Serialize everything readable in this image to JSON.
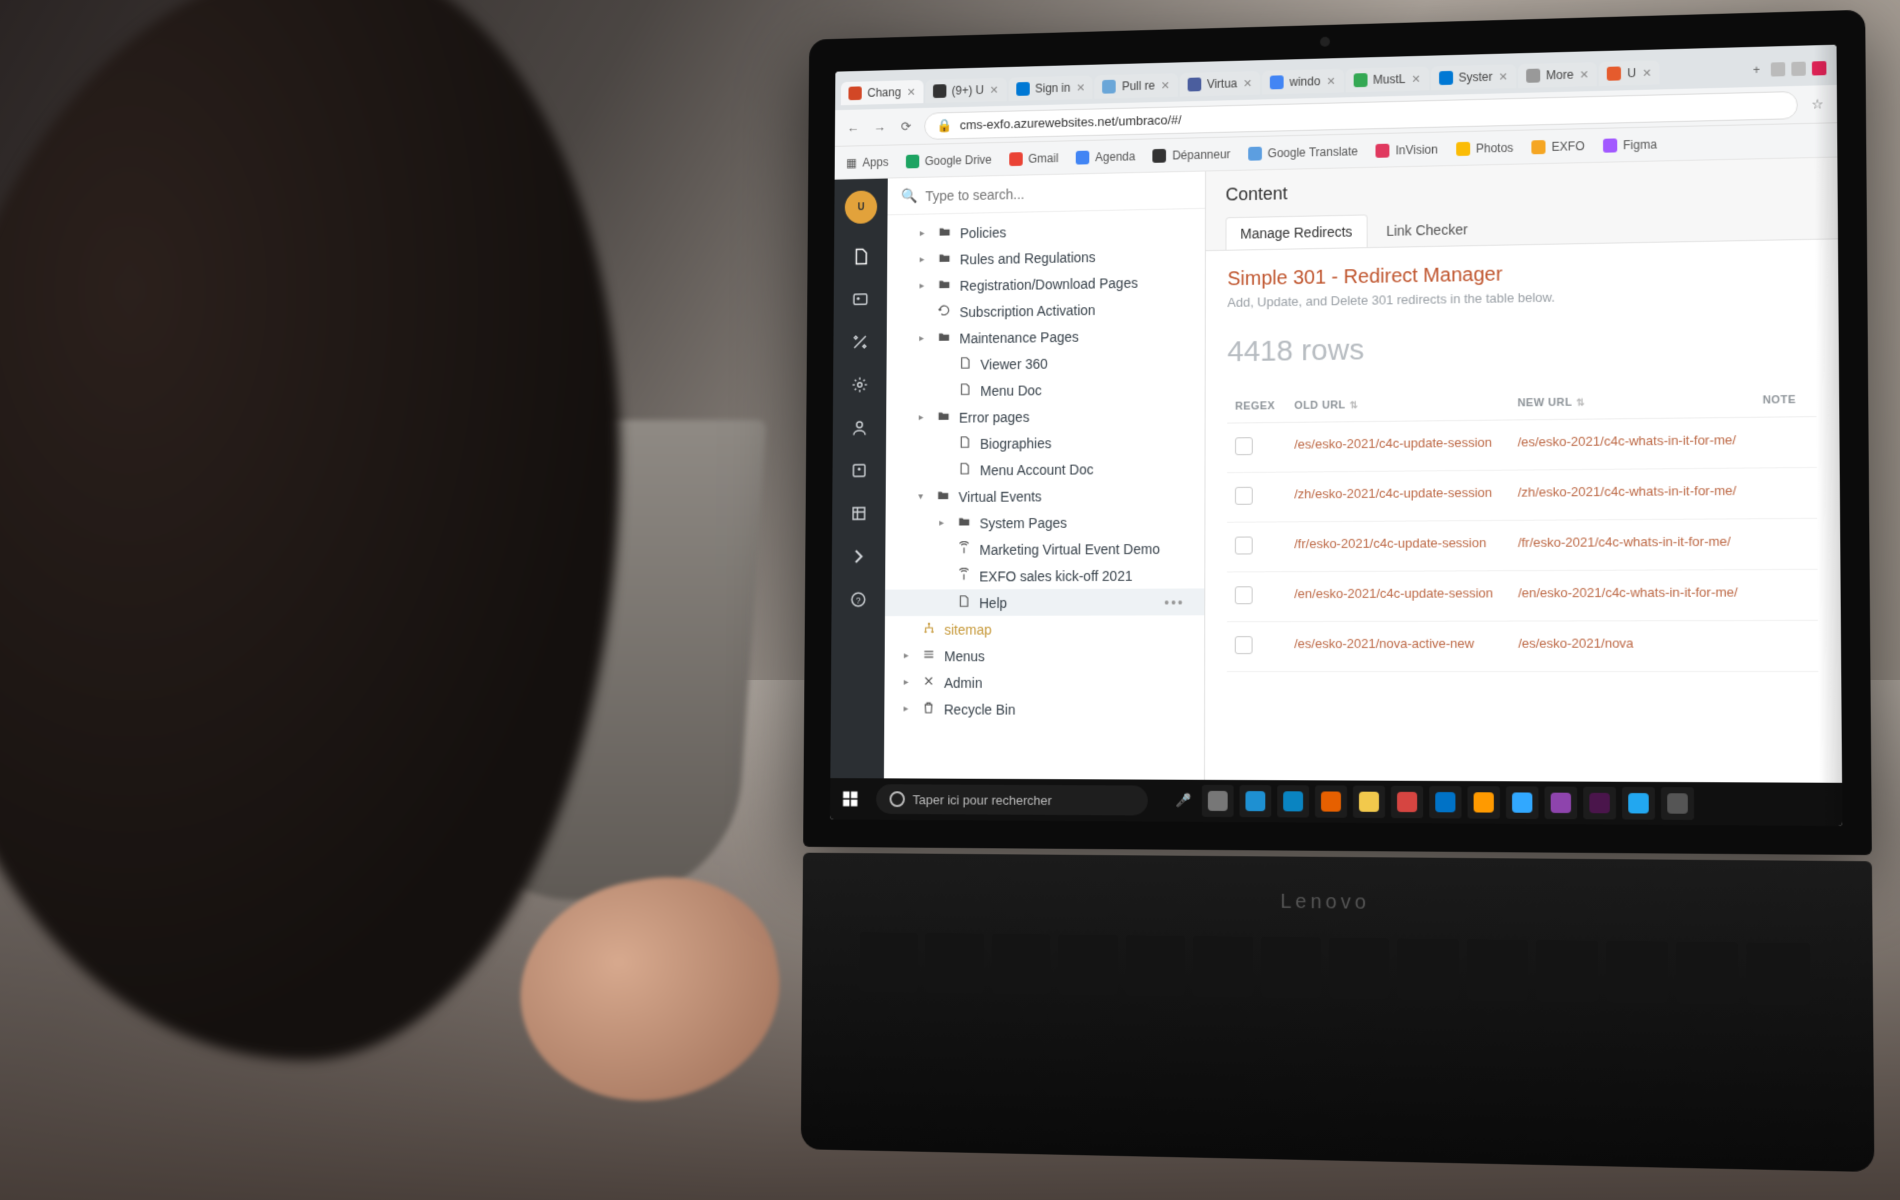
{
  "browser": {
    "tabs": [
      {
        "label": "Chang",
        "favcolor": "#d24726"
      },
      {
        "label": "(9+) U",
        "favcolor": "#333"
      },
      {
        "label": "Sign in",
        "favcolor": "#0078d4"
      },
      {
        "label": "Pull re",
        "favcolor": "#6aa6d8"
      },
      {
        "label": "Virtua",
        "favcolor": "#4b5e9e"
      },
      {
        "label": "windo",
        "favcolor": "#4285f4"
      },
      {
        "label": "MustL",
        "favcolor": "#34a853"
      },
      {
        "label": "Syster",
        "favcolor": "#0078d4"
      },
      {
        "label": "More",
        "favcolor": "#999"
      },
      {
        "label": "U",
        "favcolor": "#e55b2d"
      }
    ],
    "url": "cms-exfo.azurewebsites.net/umbraco/#/",
    "bookmarks": [
      {
        "label": "Apps",
        "color": "#888"
      },
      {
        "label": "Google Drive",
        "color": "#1da462"
      },
      {
        "label": "Gmail",
        "color": "#ea4335"
      },
      {
        "label": "Agenda",
        "color": "#4285f4"
      },
      {
        "label": "Dépanneur",
        "color": "#333"
      },
      {
        "label": "Google Translate",
        "color": "#5c9ee0"
      },
      {
        "label": "InVision",
        "color": "#e0395f"
      },
      {
        "label": "Photos",
        "color": "#fbbc05"
      },
      {
        "label": "EXFO",
        "color": "#f5a623"
      },
      {
        "label": "Figma",
        "color": "#a259ff"
      }
    ]
  },
  "search": {
    "placeholder": "Type to search..."
  },
  "tree": [
    {
      "icon": "folder",
      "label": "Policies",
      "depth": 1,
      "caret": "▸"
    },
    {
      "icon": "folder",
      "label": "Rules and Regulations",
      "depth": 1,
      "caret": "▸"
    },
    {
      "icon": "folder",
      "label": "Registration/Download Pages",
      "depth": 1,
      "caret": "▸"
    },
    {
      "icon": "refresh",
      "label": "Subscription Activation",
      "depth": 1,
      "caret": ""
    },
    {
      "icon": "folder",
      "label": "Maintenance Pages",
      "depth": 1,
      "caret": "▸"
    },
    {
      "icon": "doc",
      "label": "Viewer 360",
      "depth": 2,
      "caret": ""
    },
    {
      "icon": "doc",
      "label": "Menu Doc",
      "depth": 2,
      "caret": ""
    },
    {
      "icon": "folder",
      "label": "Error pages",
      "depth": 1,
      "caret": "▸"
    },
    {
      "icon": "doc",
      "label": "Biographies",
      "depth": 2,
      "caret": ""
    },
    {
      "icon": "doc",
      "label": "Menu Account Doc",
      "depth": 2,
      "caret": ""
    },
    {
      "icon": "folder",
      "label": "Virtual Events",
      "depth": 1,
      "caret": "▾"
    },
    {
      "icon": "folder",
      "label": "System Pages",
      "depth": 2,
      "caret": "▸"
    },
    {
      "icon": "antenna",
      "label": "Marketing Virtual Event Demo",
      "depth": 2,
      "caret": ""
    },
    {
      "icon": "antenna",
      "label": "EXFO sales kick-off 2021",
      "depth": 2,
      "caret": ""
    },
    {
      "icon": "doc",
      "label": "Help",
      "depth": 2,
      "caret": "",
      "selected": true,
      "dots": true
    },
    {
      "icon": "sitemap",
      "label": "sitemap",
      "depth": 0,
      "caret": "",
      "special": true
    },
    {
      "icon": "menu",
      "label": "Menus",
      "depth": 0,
      "caret": "▸"
    },
    {
      "icon": "tools",
      "label": "Admin",
      "depth": 0,
      "caret": "▸"
    },
    {
      "icon": "trash",
      "label": "Recycle Bin",
      "depth": 0,
      "caret": "▸"
    }
  ],
  "content": {
    "section_title": "Content",
    "tabs": [
      {
        "label": "Manage Redirects",
        "active": true
      },
      {
        "label": "Link Checker",
        "active": false
      }
    ],
    "heading": "Simple 301 - Redirect Manager",
    "subheading": "Add, Update, and Delete 301 redirects in the table below.",
    "rowcount_text": "4418 rows",
    "columns": {
      "regex": "REGEX",
      "old": "OLD URL",
      "new": "NEW URL",
      "note": "NOTE"
    },
    "rows": [
      {
        "old": "/es/esko-2021/c4c-update-session",
        "new": "/es/esko-2021/c4c-whats-in-it-for-me/"
      },
      {
        "old": "/zh/esko-2021/c4c-update-session",
        "new": "/zh/esko-2021/c4c-whats-in-it-for-me/"
      },
      {
        "old": "/fr/esko-2021/c4c-update-session",
        "new": "/fr/esko-2021/c4c-whats-in-it-for-me/"
      },
      {
        "old": "/en/esko-2021/c4c-update-session",
        "new": "/en/esko-2021/c4c-whats-in-it-for-me/"
      },
      {
        "old": "/es/esko-2021/nova-active-new",
        "new": "/es/esko-2021/nova"
      }
    ]
  },
  "taskbar": {
    "search_placeholder": "Taper ici pour rechercher",
    "apps": [
      {
        "name": "task-view",
        "color": "#777"
      },
      {
        "name": "ie",
        "color": "#1e90d2"
      },
      {
        "name": "edge",
        "color": "#0a84c1"
      },
      {
        "name": "firefox",
        "color": "#e66000"
      },
      {
        "name": "chrome",
        "color": "#f2c94c"
      },
      {
        "name": "opera",
        "color": "#d64541"
      },
      {
        "name": "mail",
        "color": "#0072c6"
      },
      {
        "name": "illustrator",
        "color": "#ff9a00"
      },
      {
        "name": "photoshop",
        "color": "#31a8ff"
      },
      {
        "name": "app-a",
        "color": "#8e44ad"
      },
      {
        "name": "slack",
        "color": "#4a154b"
      },
      {
        "name": "vscode",
        "color": "#22a7f0"
      },
      {
        "name": "app-b",
        "color": "#555"
      }
    ]
  },
  "brand": "Lenovo"
}
